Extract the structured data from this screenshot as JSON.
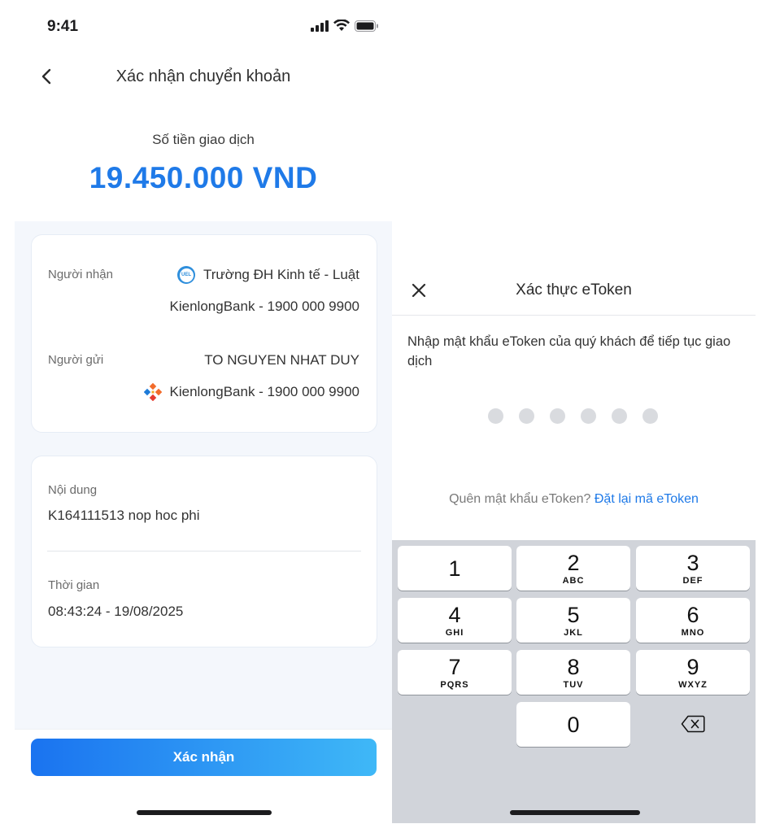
{
  "left": {
    "status_time": "9:41",
    "nav_title": "Xác nhận chuyển khoản",
    "amount_label": "Số tiền giao dịch",
    "amount_value": "19.450.000 VND",
    "recipient": {
      "label": "Người nhận",
      "name": "Trường ĐH Kinh tế - Luật",
      "bank_line": "KienlongBank - 1900 000 9900",
      "logo_text": "UEL"
    },
    "sender": {
      "label": "Người gửi",
      "name": "TO NGUYEN NHAT DUY",
      "bank_line": "KienlongBank - 1900 000 9900"
    },
    "content": {
      "label": "Nội dung",
      "value": "K164111513 nop hoc phi"
    },
    "time": {
      "label": "Thời gian",
      "value": "08:43:24 - 19/08/2025"
    },
    "confirm_label": "Xác nhận"
  },
  "right": {
    "modal_title": "Xác thực eToken",
    "instruction": "Nhập mật khẩu eToken của quý khách để tiếp tục giao dịch",
    "pin_length": 6,
    "forgot_text": "Quên mật khẩu eToken?",
    "reset_link": "Đặt lại mã eToken",
    "keys": [
      {
        "num": "1",
        "letters": ""
      },
      {
        "num": "2",
        "letters": "ABC"
      },
      {
        "num": "3",
        "letters": "DEF"
      },
      {
        "num": "4",
        "letters": "GHI"
      },
      {
        "num": "5",
        "letters": "JKL"
      },
      {
        "num": "6",
        "letters": "MNO"
      },
      {
        "num": "7",
        "letters": "PQRS"
      },
      {
        "num": "8",
        "letters": "TUV"
      },
      {
        "num": "9",
        "letters": "WXYZ"
      },
      {
        "num": "0",
        "letters": ""
      }
    ]
  },
  "colors": {
    "accent": "#1f7ae8",
    "button_gradient_start": "#1a73f0",
    "button_gradient_end": "#3fb8f7",
    "keypad_bg": "#d1d4da"
  },
  "icons": {
    "back": "chevron-left-icon",
    "close": "close-icon",
    "signal": "signal-icon",
    "wifi": "wifi-icon",
    "battery": "battery-icon",
    "backspace": "backspace-icon",
    "kienlong_logo": "kienlong-logo-icon",
    "uel_logo": "uel-logo-icon"
  }
}
